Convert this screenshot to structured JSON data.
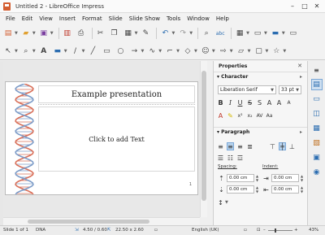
{
  "window": {
    "title": "Untitled 2 - LibreOffice Impress",
    "minimize": "–",
    "maximize": "□",
    "close": "✕"
  },
  "menu": [
    "File",
    "Edit",
    "View",
    "Insert",
    "Format",
    "Slide",
    "Slide Show",
    "Tools",
    "Window",
    "Help"
  ],
  "slide": {
    "title": "Example presentation",
    "content": "Click to add Text",
    "page_number": "1"
  },
  "sidebar": {
    "title": "Properties",
    "close": "✕",
    "character": {
      "heading": "Character",
      "font_name": "Liberation Serif",
      "font_size": "33 pt"
    },
    "paragraph": {
      "heading": "Paragraph",
      "spacing_label": "Spacing:",
      "indent_label": "Indent:",
      "above": "0.00 cm",
      "below": "0.00 cm",
      "before": "0.00 cm",
      "after": "0.00 cm"
    }
  },
  "status": {
    "slide": "Slide 1 of 1",
    "master": "DNA",
    "position": "4.50 / 0.60",
    "size": "22.50 x 2.60",
    "language": "English (UK)",
    "zoom": "43%"
  },
  "colors": {
    "helix_red": "#d9705a",
    "helix_blue": "#7d9cc8",
    "active_blue": "#7aa7d6",
    "app_orange": "#d35d30"
  }
}
